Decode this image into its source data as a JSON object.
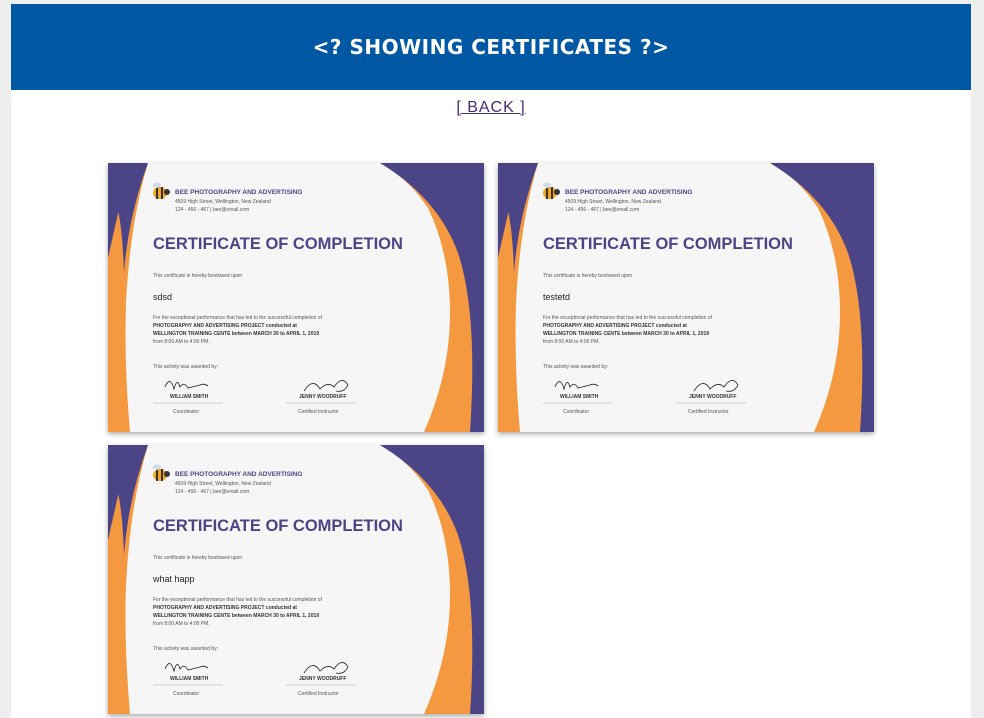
{
  "header": {
    "title": "<? SHOWING CERTIFICATES ?>"
  },
  "nav": {
    "back_label": "[ BACK ]"
  },
  "colors": {
    "header_bg": "#0057a3",
    "cert_purple": "#4b4587",
    "cert_orange": "#f4993f",
    "link": "#4a2a73"
  },
  "certificates": [
    {
      "company": "BEE PHOTOGRAPHY AND ADVERTISING",
      "address": "4509 High Street, Wellington, New Zealand",
      "contact": "124 - 456 - 467 | bee@email.com",
      "title": "CERTIFICATE OF COMPLETION",
      "bestowed": "This certificate is hereby bestowed upon",
      "recipient": "sdsd",
      "performance_line1": "For the exceptional performance that has led to the successful completion of",
      "performance_line2": "PHOTOGRAPHY AND ADVERTISING PROJECT  conducted at",
      "performance_line3": "WELLINGTON TRAINING CENTE between MARCH 30 to APRIL 1, 2019",
      "performance_line4": "from 8:00 AM to 4:00 PM.",
      "awarded_by": "This activity was awarded by:",
      "signer1_name": "WILLIAM SMITH",
      "signer1_role": "Coordinator",
      "signer2_name": "JENNY WOODRUFF",
      "signer2_role": "Certified Instructor"
    },
    {
      "company": "BEE PHOTOGRAPHY AND ADVERTISING",
      "address": "4509 High Street, Wellington, New Zealand",
      "contact": "124 - 456 - 467 | bee@email.com",
      "title": "CERTIFICATE OF COMPLETION",
      "bestowed": "This certificate is hereby bestowed upon",
      "recipient": "testetd",
      "performance_line1": "For the exceptional performance that has led to the successful completion of",
      "performance_line2": "PHOTOGRAPHY AND ADVERTISING PROJECT  conducted at",
      "performance_line3": "WELLINGTON TRAINING CENTE between MARCH 30 to APRIL 1, 2019",
      "performance_line4": "from 8:00 AM to 4:00 PM.",
      "awarded_by": "This activity was awarded by:",
      "signer1_name": "WILLIAM SMITH",
      "signer1_role": "Coordinator",
      "signer2_name": "JENNY WOODRUFF",
      "signer2_role": "Certified Instructor"
    },
    {
      "company": "BEE PHOTOGRAPHY AND ADVERTISING",
      "address": "4509 High Street, Wellington, New Zealand",
      "contact": "124 - 456 - 467 | bee@email.com",
      "title": "CERTIFICATE OF COMPLETION",
      "bestowed": "This certificate is hereby bestowed upon",
      "recipient": "what happ",
      "performance_line1": "For the exceptional performance that has led to the successful completion of",
      "performance_line2": "PHOTOGRAPHY AND ADVERTISING PROJECT  conducted at",
      "performance_line3": "WELLINGTON TRAINING CENTE between MARCH 30 to APRIL 1, 2019",
      "performance_line4": "from 8:00 AM to 4:00 PM.",
      "awarded_by": "This activity was awarded by:",
      "signer1_name": "WILLIAM SMITH",
      "signer1_role": "Coordinator",
      "signer2_name": "JENNY WOODRUFF",
      "signer2_role": "Certified Instructor"
    }
  ]
}
